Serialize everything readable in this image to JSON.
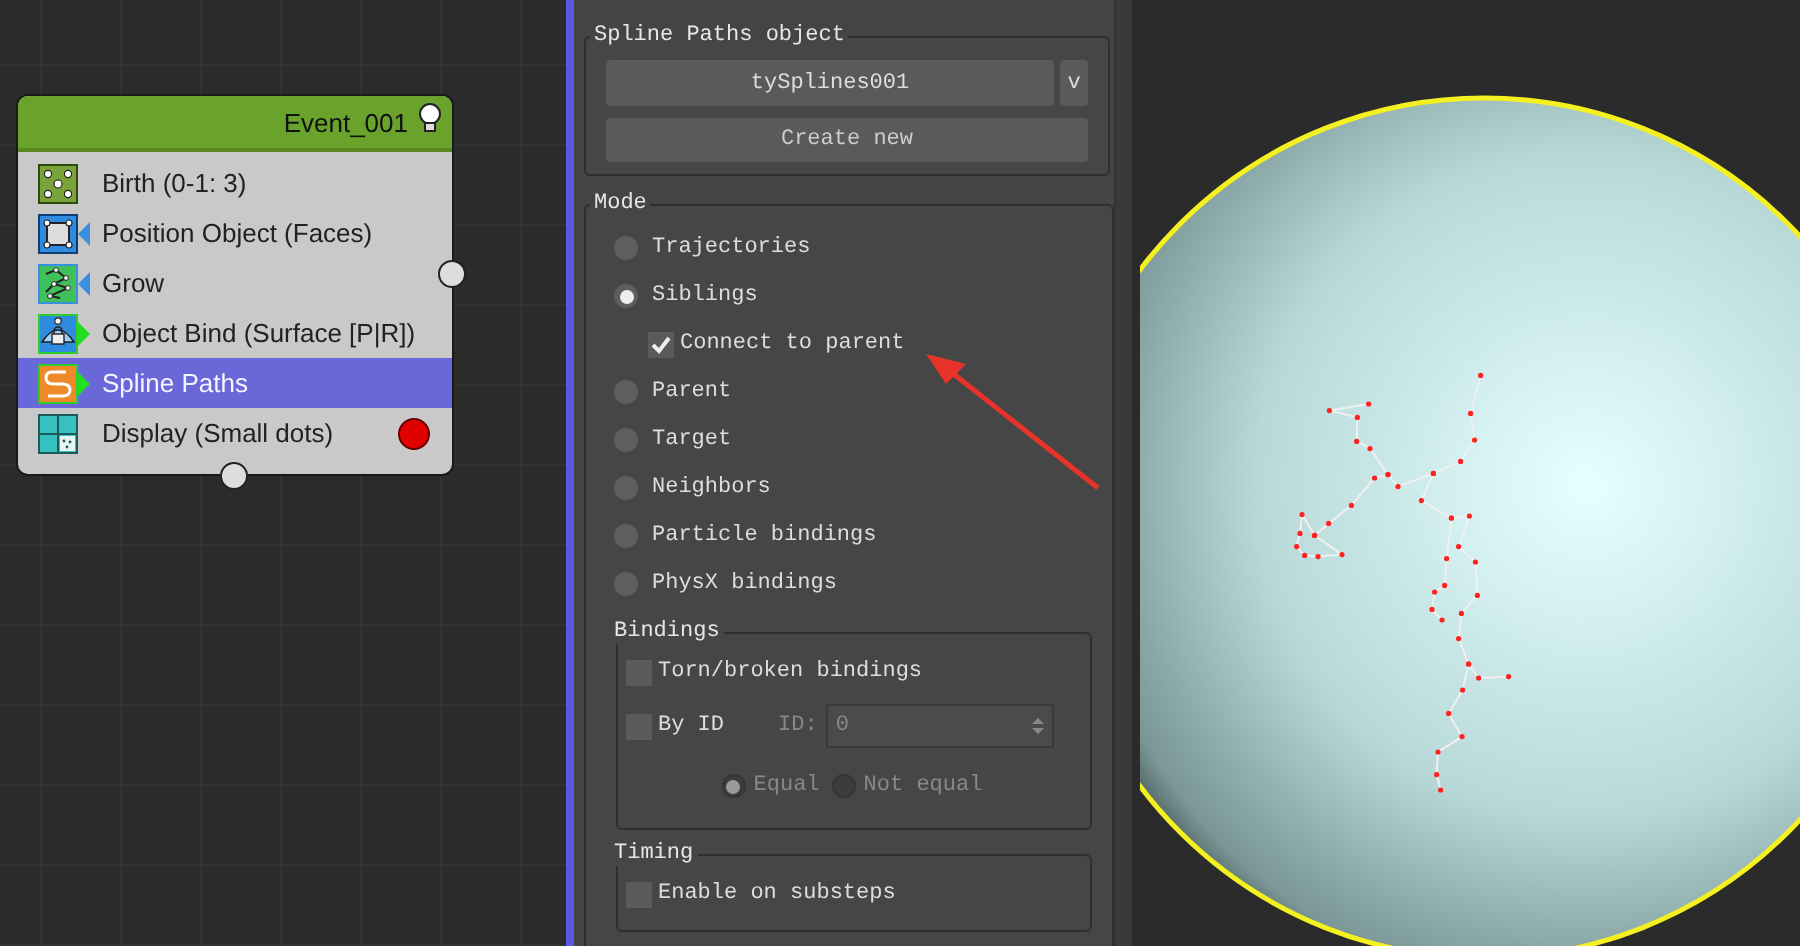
{
  "node": {
    "title": "Event_001",
    "operators": [
      {
        "kind": "birth",
        "label": "Birth (0-1: 3)",
        "selected": false
      },
      {
        "kind": "position",
        "label": "Position Object (Faces)",
        "selected": false
      },
      {
        "kind": "grow",
        "label": "Grow",
        "selected": false
      },
      {
        "kind": "bind",
        "label": "Object Bind (Surface [P|R])",
        "selected": false
      },
      {
        "kind": "spline",
        "label": "Spline Paths",
        "selected": true
      },
      {
        "kind": "display",
        "label": "Display (Small dots)",
        "selected": false
      }
    ]
  },
  "panel": {
    "object_group": {
      "title": "Spline Paths object",
      "dropdown_value": "tySplines001",
      "dropdown_button": "v",
      "create_button": "Create new"
    },
    "mode": {
      "title": "Mode",
      "options": [
        {
          "label": "Trajectories",
          "selected": false
        },
        {
          "label": "Siblings",
          "selected": true,
          "sub_option": {
            "label": "Connect to parent",
            "checked": true
          }
        },
        {
          "label": "Parent",
          "selected": false
        },
        {
          "label": "Target",
          "selected": false
        },
        {
          "label": "Neighbors",
          "selected": false
        },
        {
          "label": "Particle bindings",
          "selected": false
        },
        {
          "label": "PhysX bindings",
          "selected": false
        }
      ]
    },
    "bindings": {
      "title": "Bindings",
      "checkboxes": [
        {
          "label": "Torn/broken bindings",
          "checked": false
        }
      ],
      "by_id": {
        "label": "By ID",
        "checked": false,
        "id_label": "ID:",
        "id_value": "0",
        "disabled": true
      },
      "radios": [
        {
          "label": "Equal",
          "selected": true,
          "disabled": true
        },
        {
          "label": "Not equal",
          "selected": false,
          "disabled": true
        }
      ]
    },
    "timing": {
      "title": "Timing",
      "checkboxes": [
        {
          "label": "Enable on substeps",
          "checked": false
        }
      ]
    }
  }
}
